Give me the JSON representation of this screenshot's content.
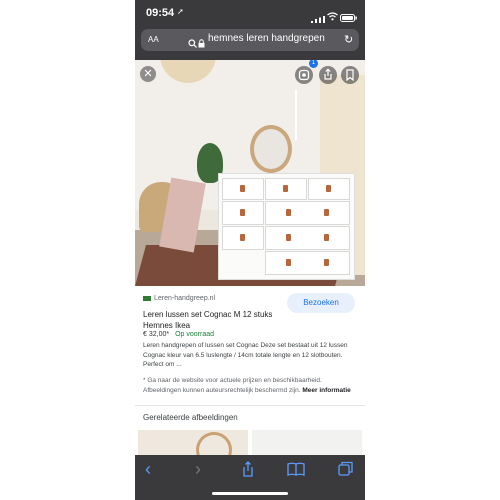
{
  "status_bar": {
    "time": "09:54",
    "location_arrow": "➚"
  },
  "address_bar": {
    "text_size_label": "AA",
    "url": "hemnes leren handgrepen",
    "reload_glyph": "↻"
  },
  "image_viewer": {
    "close_glyph": "✕",
    "lens_badge": "1"
  },
  "result": {
    "source": "Leren-handgreep.nl",
    "visit_label": "Bezoeken",
    "title": "Leren lussen set Cognac M 12 stuks Hemnes Ikea",
    "price": "€ 32,00*",
    "stock": "Op voorraad",
    "description": "Leren handgrepen of lussen set Cognac Deze set bestaat uit 12 lussen Cognac kleur van 6.5 luslengte / 14cm totale lengte en 12 slotbouten. Perfect om ...",
    "note": "* Ga naar de website voor actuele prijzen en beschikbaarheid. Afbeeldingen kunnen auteursrechtelijk beschermd zijn.",
    "more_info": "Meer informatie"
  },
  "related": {
    "heading": "Gerelateerde afbeeldingen"
  },
  "toolbar": {
    "back_glyph": "‹",
    "forward_glyph": "›"
  },
  "colors": {
    "chrome": "#3a3a3c",
    "link_blue": "#1a73e8",
    "in_stock_green": "#188038"
  }
}
